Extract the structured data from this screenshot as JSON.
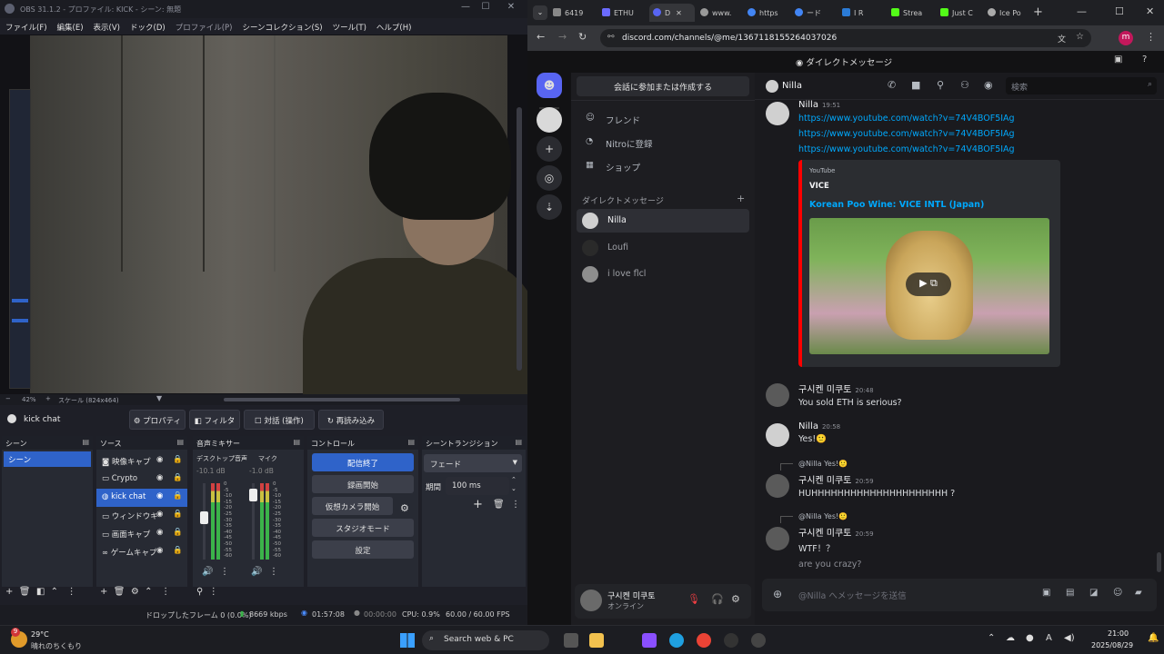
{
  "obs": {
    "title": "OBS 31.1.2 - プロファイル: KICK - シーン: 無題",
    "menu": [
      "ファイル(F)",
      "編集(E)",
      "表示(V)",
      "ドック(D)",
      "プロファイル(P)",
      "シーンコレクション(S)",
      "ツール(T)",
      "ヘルプ(H)"
    ],
    "zoom": "42%",
    "scale": "スケール (824x464)",
    "selected_source": "kick chat",
    "source_buttons": [
      "プロパティ",
      "フィルタ",
      "対話 (操作)",
      "再読み込み"
    ],
    "docks": {
      "scenes": "シーン",
      "sources": "ソース",
      "mixer": "音声ミキサー",
      "controls": "コントロール",
      "transitions": "シーントランジション"
    },
    "scenes": [
      "シーン"
    ],
    "sources": [
      "映像キャプ",
      "Crypto",
      "kick chat",
      "ウィンドウキ",
      "画面キャプ",
      "ゲームキャプ"
    ],
    "mixer": [
      {
        "name": "デスクトップ音声",
        "db": "-10.1 dB",
        "level": 0.55
      },
      {
        "name": "マイク",
        "db": "-1.0 dB",
        "level": 0.85
      }
    ],
    "meter_ticks": [
      "0",
      "-5",
      "-10",
      "-15",
      "-20",
      "-25",
      "-30",
      "-35",
      "-40",
      "-45",
      "-50",
      "-55",
      "-60"
    ],
    "controls": [
      "配信終了",
      "録画開始",
      "仮想カメラ開始",
      "スタジオモード",
      "設定"
    ],
    "transition": {
      "type": "フェード",
      "duration_label": "期間",
      "duration": "100 ms"
    },
    "status": {
      "dropped": "ドロップしたフレーム 0 (0.0%)",
      "bitrate": "8669 kbps",
      "live_time": "01:57:08",
      "rec_time": "00:00:00",
      "cpu": "CPU: 0.9%",
      "fps": "60.00 / 60.00 FPS"
    }
  },
  "browser": {
    "tabs": [
      {
        "label": "6419",
        "color": "#888888"
      },
      {
        "label": "ETHU",
        "color": "#6b6bff"
      },
      {
        "label": "D",
        "color": "#5865f2"
      },
      {
        "label": "www.",
        "color": "#999999"
      },
      {
        "label": "https",
        "color": "#4285f4"
      },
      {
        "label": "ード",
        "color": "#4285f4"
      },
      {
        "label": "I R",
        "color": "#2b7bd6"
      },
      {
        "label": "Strea",
        "color": "#53fc18"
      },
      {
        "label": "Just C",
        "color": "#53fc18"
      },
      {
        "label": "Ice Po",
        "color": "#aaaaaa"
      }
    ],
    "url": "discord.com/channels/@me/1367118155264037026",
    "profile_initial": "m"
  },
  "discord": {
    "header": "ダイレクトメッセージ",
    "find_button": "会話に参加または作成する",
    "nav": [
      "フレンド",
      "Nitroに登録",
      "ショップ"
    ],
    "dm_section": "ダイレクトメッセージ",
    "dms": [
      "Nilla",
      "Loufi",
      "i love flcl"
    ],
    "channel": "Nilla",
    "search_placeholder": "検索",
    "user": {
      "name": "구시켄 미쿠토",
      "status": "オンライン"
    },
    "composer_placeholder": "@Nilla へメッセージを送信",
    "messages": {
      "m1": {
        "author": "Nilla",
        "time": "19:51",
        "links": [
          "https://www.youtube.com/watch?v=74V4BOF5IAg",
          "https://www.youtube.com/watch?v=74V4BOF5IAg",
          "https://www.youtube.com/watch?v=74V4BOF5IAg"
        ]
      },
      "embed": {
        "provider": "YouTube",
        "author": "VICE",
        "title": "Korean Poo Wine: VICE INTL (Japan)"
      },
      "m2": {
        "author": "구시켄 미쿠토",
        "time": "20:48",
        "text": "You sold ETH is serious?"
      },
      "m3": {
        "author": "Nilla",
        "time": "20:58",
        "text": "Yes!🙂"
      },
      "m4": {
        "reply": "@Nilla Yes!🙂",
        "author": "구시켄 미쿠토",
        "time": "20:59",
        "text": "HUHHHHHHHHHHHHHHHHHHHHH ?"
      },
      "m5": {
        "reply": "@Nilla Yes!🙂",
        "author": "구시켄 미쿠토",
        "time": "20:59",
        "text": "WTF！？",
        "text2": "are you crazy?"
      }
    }
  },
  "taskbar": {
    "weather_temp": "29°C",
    "weather_desc": "晴れのちくもり",
    "search": "Search web & PC",
    "time": "21:00",
    "date": "2025/08/29",
    "badge": "9"
  }
}
